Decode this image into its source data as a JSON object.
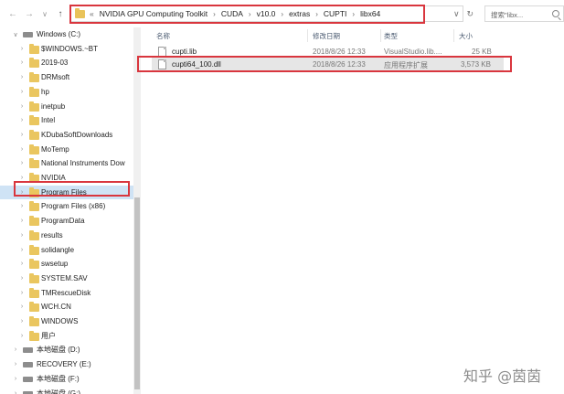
{
  "nav": {
    "back_glyph": "←",
    "forward_glyph": "→",
    "down_glyph": "∨",
    "up_glyph": "↑"
  },
  "address": {
    "lead": "«",
    "crumbs": [
      "NVIDIA GPU Computing Toolkit",
      "CUDA",
      "v10.0",
      "extras",
      "CUPTI",
      "libx64"
    ],
    "separator": "›",
    "dropdown_glyph": "∨",
    "refresh_glyph": "↻"
  },
  "search": {
    "placeholder": "搜索\"libx..."
  },
  "tree": [
    {
      "label": "Windows (C:)",
      "type": "drive",
      "expanded": true
    },
    {
      "label": "$WINDOWS.~BT",
      "type": "folder"
    },
    {
      "label": "2019-03",
      "type": "folder"
    },
    {
      "label": "DRMsoft",
      "type": "folder"
    },
    {
      "label": "hp",
      "type": "folder"
    },
    {
      "label": "inetpub",
      "type": "folder"
    },
    {
      "label": "Intel",
      "type": "folder"
    },
    {
      "label": "KDubaSoftDownloads",
      "type": "folder"
    },
    {
      "label": "MoTemp",
      "type": "folder"
    },
    {
      "label": "National Instruments Dow",
      "type": "folder"
    },
    {
      "label": "NVIDIA",
      "type": "folder"
    },
    {
      "label": "Program Files",
      "type": "folder",
      "selected": true
    },
    {
      "label": "Program Files (x86)",
      "type": "folder"
    },
    {
      "label": "ProgramData",
      "type": "folder"
    },
    {
      "label": "results",
      "type": "folder"
    },
    {
      "label": "solidangle",
      "type": "folder"
    },
    {
      "label": "swsetup",
      "type": "folder"
    },
    {
      "label": "SYSTEM.SAV",
      "type": "folder"
    },
    {
      "label": "TMRescueDisk",
      "type": "folder"
    },
    {
      "label": "WCH.CN",
      "type": "folder"
    },
    {
      "label": "WINDOWS",
      "type": "folder"
    },
    {
      "label": "用户",
      "type": "folder"
    },
    {
      "label": "本地磁盘 (D:)",
      "type": "drive"
    },
    {
      "label": "RECOVERY (E:)",
      "type": "drive"
    },
    {
      "label": "本地磁盘 (F:)",
      "type": "drive"
    },
    {
      "label": "本地磁盘 (G:)",
      "type": "drive"
    }
  ],
  "columns": {
    "name": "名称",
    "modified": "修改日期",
    "type": "类型",
    "size": "大小"
  },
  "files": [
    {
      "name": "cupti.lib",
      "modified": "2018/8/26 12:33",
      "type": "VisualStudio.lib....",
      "size": "25 KB"
    },
    {
      "name": "cupti64_100.dll",
      "modified": "2018/8/26 12:33",
      "type": "应用程序扩展",
      "size": "3,573 KB"
    }
  ],
  "watermark": "知乎 @茵茵",
  "colors": {
    "highlight": "#d9363e",
    "folder": "#eac65f",
    "selection": "#cfe3f5"
  }
}
